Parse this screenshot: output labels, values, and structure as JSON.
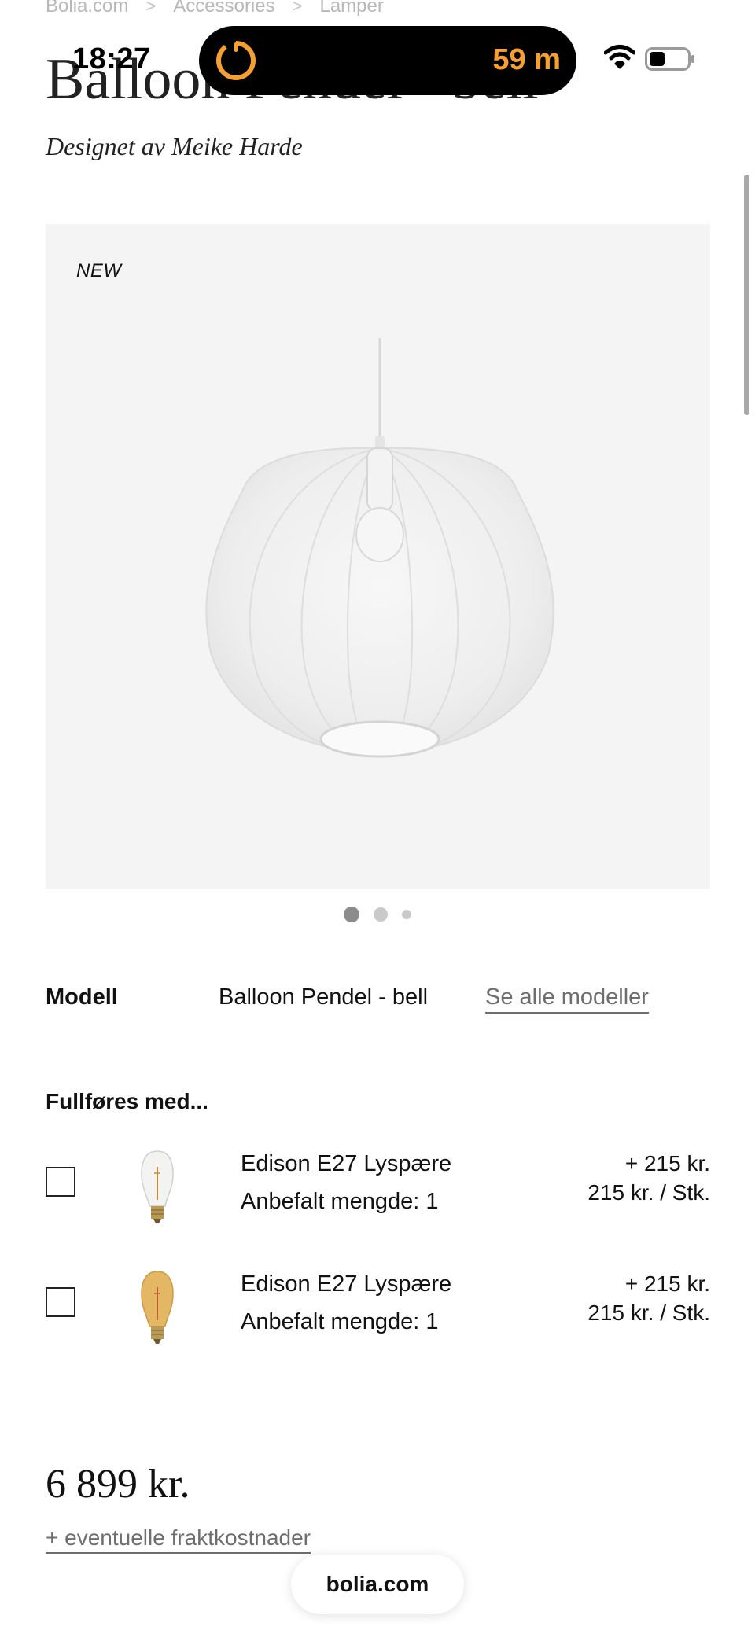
{
  "status_bar": {
    "time": "18:27",
    "timer_text": "59 m",
    "accent_color": "#f5a030"
  },
  "breadcrumb": {
    "items": [
      "Bolia.com",
      "Accessories",
      "Lamper"
    ],
    "separator": ">"
  },
  "product": {
    "title": "Balloon Pendel - bell",
    "designer": "Designet av Meike Harde",
    "badge": "NEW",
    "image_count": 3,
    "active_image_index": 0
  },
  "model": {
    "label": "Modell",
    "value": "Balloon Pendel - bell",
    "link": "Se alle modeller"
  },
  "accessories": {
    "heading": "Fullføres med...",
    "items": [
      {
        "name": "Edison E27 Lyspære",
        "quantity": "Anbefalt mengde: 1",
        "price": "+ 215 kr.",
        "unit_price": "215 kr. / Stk.",
        "icon": "clear-bulb-icon",
        "checked": false
      },
      {
        "name": "Edison E27 Lyspære",
        "quantity": "Anbefalt mengde: 1",
        "price": "+ 215 kr.",
        "unit_price": "215 kr. / Stk.",
        "icon": "amber-bulb-icon",
        "checked": false
      }
    ]
  },
  "pricing": {
    "price": "6 899 kr.",
    "shipping": "+ eventuelle fraktkostnader"
  },
  "browser": {
    "url": "bolia.com"
  }
}
